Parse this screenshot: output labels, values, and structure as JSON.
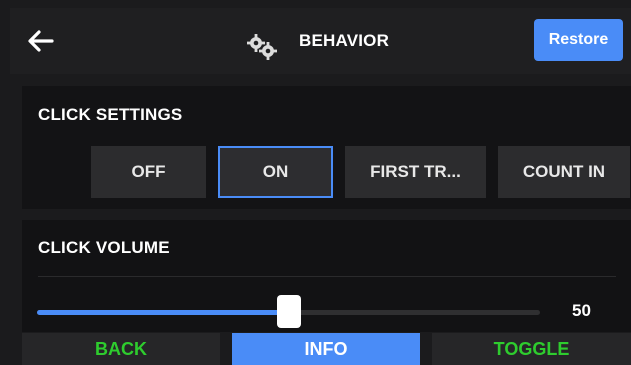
{
  "header": {
    "title": "BEHAVIOR",
    "restore_label": "Restore",
    "back_icon": "back-arrow-icon",
    "settings_icon": "gears-icon"
  },
  "click_settings": {
    "label": "CLICK SETTINGS",
    "options": [
      "OFF",
      "ON",
      "FIRST TR...",
      "COUNT IN"
    ],
    "selected": "ON"
  },
  "click_volume": {
    "label": "CLICK VOLUME",
    "value": "50",
    "level": 0.5
  },
  "bottom_bar": {
    "back_label": "BACK",
    "info_label": "INFO",
    "toggle_label": "TOGGLE"
  },
  "colors": {
    "accent": "#4a8cf7",
    "green": "#2ecc2e",
    "background": "#1b1b1d"
  }
}
